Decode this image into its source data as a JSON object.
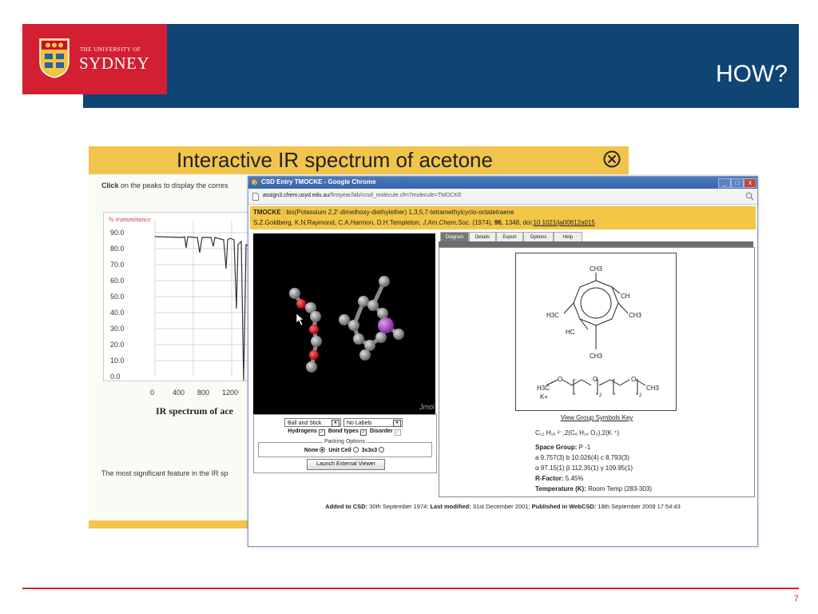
{
  "slide": {
    "university_small": "THE UNIVERSITY OF",
    "university_big": "SYDNEY",
    "title": "HOW?",
    "page_number": "7",
    "colors": {
      "header": "#0f4473",
      "logo": "#d21f31",
      "accent": "#f1c44c"
    }
  },
  "ir_page": {
    "title": "Interactive IR spectrum of acetone",
    "close_icon": "circled-x-icon",
    "instruction_bold": "Click",
    "instruction_rest": " on the peaks to display the corres",
    "y_axis_label": "% transmittance",
    "y_ticks": [
      "90.0",
      "80.0",
      "70.0",
      "60.0",
      "50.0",
      "40.0",
      "30.0",
      "20.0",
      "10.0",
      "0.0"
    ],
    "x_ticks": [
      "0",
      "400",
      "800",
      "1200"
    ],
    "caption": "IR spectrum of ace",
    "bottom_text": "The most significant feature in the IR sp"
  },
  "browser": {
    "title": "CSD Entry TMOCKE - Google Chrome",
    "url_host": "assign3.chem.usyd.edu.au",
    "url_path": "/firstyear/lab/ccsd_molecule.cfm?molecule=TMOCKE",
    "buttons": {
      "minimize": "_",
      "maximize": "□",
      "close": "x"
    }
  },
  "entry": {
    "refcode": "TMOCKE",
    "name": " : bis(Potassium 2,2'-dimethoxy-diethylether) 1,3,5,7-tetramethylcyclo-octatetraene",
    "authors": "S.Z.Goldberg, K.N.Raymond, C.A.Harmon, D.H.Templeton; ",
    "journal": "J.Am.Chem.Soc.",
    "year": " (1974), ",
    "volume": "96",
    "pages": ", 1348, doi:",
    "doi": "10.1021/ja00812a015"
  },
  "viewer": {
    "label": "Jmol",
    "style_select": "Ball and Stick",
    "labels_select": "No Labels",
    "hydrogens": "Hydrogens",
    "bond_types": "Bond types",
    "disorder": "Disorder",
    "packing_legend": "Packing Options",
    "pack_none": "None",
    "pack_unit": "Unit Cell",
    "pack_3x3": "3x3x3",
    "launch": "Launch External Viewer"
  },
  "tabs": [
    "Diagram",
    "Details",
    "Export",
    "Options",
    "Help"
  ],
  "diagram": {
    "labels": {
      "ch3_top": "CH3",
      "ch": "CH",
      "h3c_left": "H3C",
      "ch3_right": "CH3",
      "hc": "HC",
      "ch3_bottom": "CH3",
      "ether_h3c": "H3C",
      "ether_o1": "O",
      "ether_o2": "O",
      "ether_o3": "O",
      "ether_ch3": "CH3",
      "ether_k": "K+",
      "sub2a": "2",
      "sub2b": "2"
    }
  },
  "details": {
    "key_link": "View Group Symbols Key",
    "formula": "C₁₂ H₁₆ ²⁻,2(C₆ H₁₄ O₃),2(K ⁺)",
    "space_group_label": "Space Group:",
    "space_group": " P -1",
    "cell_lengths": "a 9.757(3) b 10.026(4) c 8.793(3)",
    "cell_angles": "α 97.15(1) β 112.35(1) γ 109.95(1)",
    "r_factor_label": "R-Factor:",
    "r_factor": " 5.45%",
    "temperature_label": "Temperature (K):",
    "temperature": " Room Temp (283-303)"
  },
  "footer": {
    "added_label": "Added to CSD:",
    "added": " 30th September 1974; ",
    "modified_label": "Last modified:",
    "modified": " 31st December 2001; ",
    "published_label": "Published in WebCSD:",
    "published": " 18th September 2009 17:54:43"
  }
}
